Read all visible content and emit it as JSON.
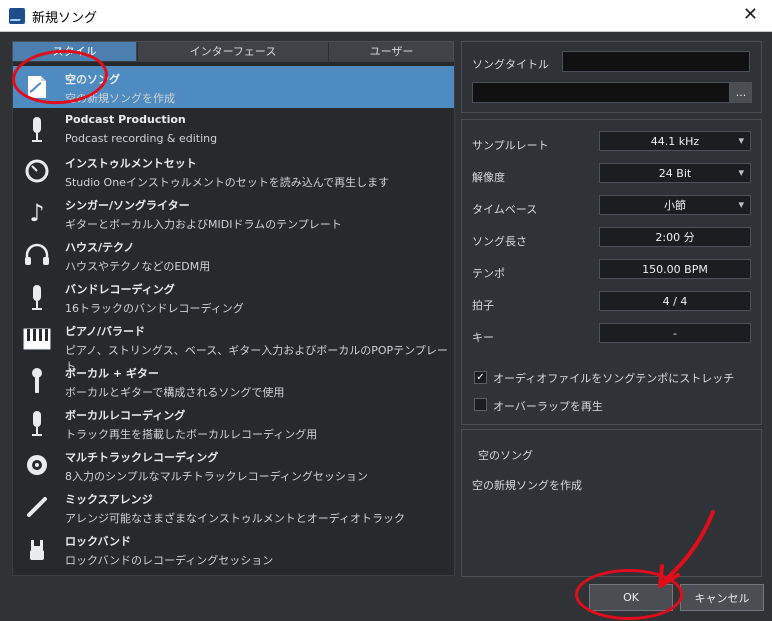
{
  "window": {
    "title": "新規ソング",
    "close_symbol": "✕"
  },
  "tabs": [
    "スタイル",
    "インターフェース",
    "ユーザー"
  ],
  "templates": [
    {
      "name": "空のソング",
      "desc": "空の新規ソングを作成",
      "icon": "page-curve-icon"
    },
    {
      "name": "Podcast Production",
      "desc": "Podcast recording & editing",
      "icon": "microphone-icon"
    },
    {
      "name": "インストゥルメントセット",
      "desc": "Studio Oneインストゥルメントのセットを読み込んで再生します",
      "icon": "instrument-dial-icon"
    },
    {
      "name": "シンガー/ソングライター",
      "desc": "ギターとボーカル入力およびMIDIドラムのテンプレート",
      "icon": "music-note-icon"
    },
    {
      "name": "ハウス/テクノ",
      "desc": "ハウスやテクノなどのEDM用",
      "icon": "headphones-icon"
    },
    {
      "name": "バンドレコーディング",
      "desc": "16トラックのバンドレコーディング",
      "icon": "mic-band-icon"
    },
    {
      "name": "ピアノ/バラード",
      "desc": "ピアノ、ストリングス、ベース、ギター入力およびボーカルのPOPテンプレート",
      "icon": "piano-keys-icon"
    },
    {
      "name": "ボーカル + ギター",
      "desc": "ボーカルとギターで構成されるソングで使用",
      "icon": "hand-mic-icon"
    },
    {
      "name": "ボーカルレコーディング",
      "desc": "トラック再生を搭載したボーカルレコーディング用",
      "icon": "vocal-mic-icon"
    },
    {
      "name": "マルチトラックレコーディング",
      "desc": "8入力のシンプルなマルチトラックレコーディングセッション",
      "icon": "vinyl-icon"
    },
    {
      "name": "ミックスアレンジ",
      "desc": "アレンジ可能なさまざまなインストゥルメントとオーディオトラック",
      "icon": "cable-icon"
    },
    {
      "name": "ロックバンド",
      "desc": "ロックバンドのレコーディングセッション",
      "icon": "rock-hand-icon"
    }
  ],
  "song": {
    "title_label": "ソングタイトル",
    "browse": "..."
  },
  "settings": {
    "sample_rate_label": "サンプルレート",
    "sample_rate": "44.1 kHz",
    "bit_depth_label": "解像度",
    "bit_depth": "24 Bit",
    "timebase_label": "タイムベース",
    "timebase": "小節",
    "length_label": "ソング長さ",
    "length": "2:00 分",
    "tempo_label": "テンポ",
    "tempo": "150.00 BPM",
    "signature_label": "拍子",
    "signature": "4  /  4",
    "key_label": "キー",
    "key": "-",
    "stretch_label": "オーディオファイルをソングテンポにストレッチ",
    "overlap_label": "オーバーラップを再生"
  },
  "desc_panel": {
    "title": "空のソング",
    "body": "空の新規ソングを作成"
  },
  "buttons": {
    "ok": "OK",
    "cancel": "キャンセル"
  },
  "check_mark": "✓",
  "colors": {
    "selection": "#4d8bc0",
    "annotation": "#e20d1a"
  }
}
